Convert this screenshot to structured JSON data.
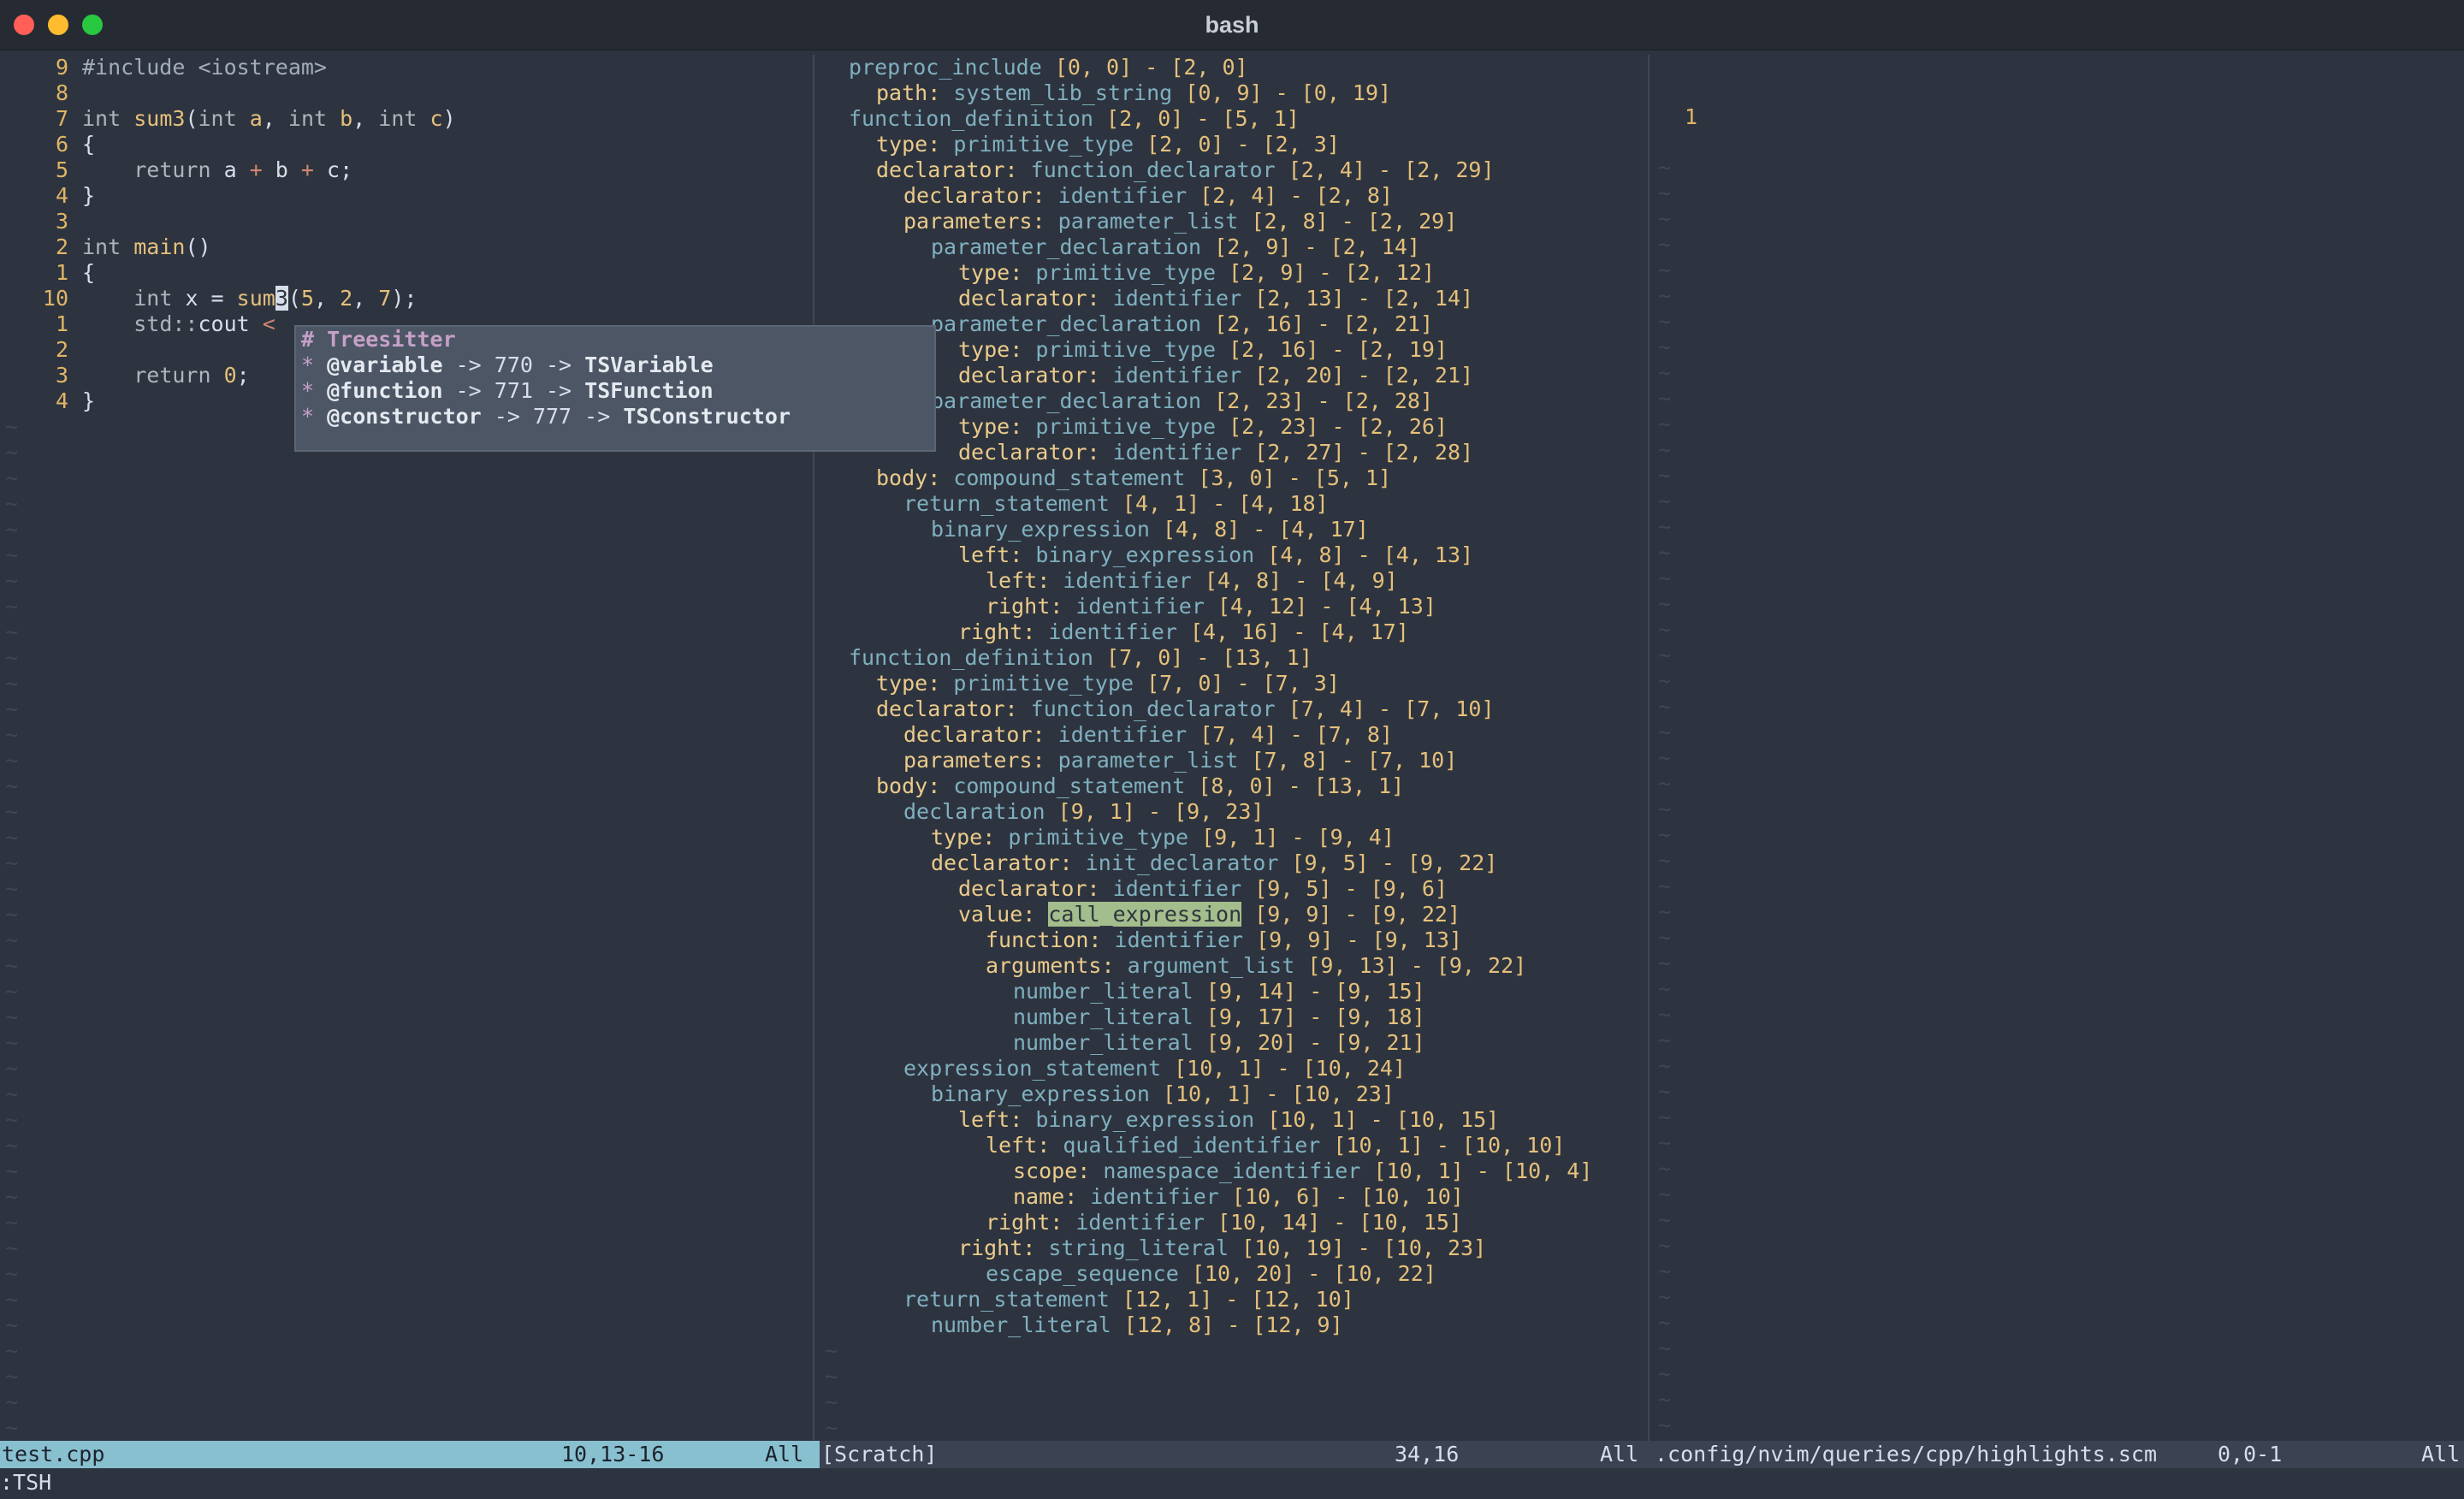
{
  "window": {
    "title": "bash"
  },
  "left": {
    "lines": [
      {
        "n": "9",
        "parts": [
          [
            "pp",
            "#include <iostream>"
          ]
        ]
      },
      {
        "n": "8",
        "parts": []
      },
      {
        "n": "7",
        "parts": [
          [
            "kw",
            "int "
          ],
          [
            "fn",
            "sum3"
          ],
          [
            "",
            "("
          ],
          [
            "kw",
            "int "
          ],
          [
            "fn",
            "a"
          ],
          [
            "",
            ", "
          ],
          [
            "kw",
            "int "
          ],
          [
            "fn",
            "b"
          ],
          [
            "",
            ", "
          ],
          [
            "kw",
            "int "
          ],
          [
            "fn",
            "c"
          ],
          [
            "",
            ")"
          ]
        ]
      },
      {
        "n": "6",
        "parts": [
          [
            "",
            "{"
          ]
        ]
      },
      {
        "n": "5",
        "parts": [
          [
            "",
            "    "
          ],
          [
            "kw",
            "return "
          ],
          [
            "",
            "a "
          ],
          [
            "op",
            "+"
          ],
          [
            "",
            " b "
          ],
          [
            "op",
            "+"
          ],
          [
            "",
            " c;"
          ]
        ]
      },
      {
        "n": "4",
        "parts": [
          [
            "",
            "}"
          ]
        ]
      },
      {
        "n": "3",
        "parts": []
      },
      {
        "n": "2",
        "parts": [
          [
            "kw",
            "int "
          ],
          [
            "fn",
            "main"
          ],
          [
            "",
            "()"
          ]
        ]
      },
      {
        "n": "1",
        "parts": [
          [
            "",
            "{"
          ]
        ]
      },
      {
        "n": "10",
        "cur": true,
        "parts": [
          [
            "",
            "    "
          ],
          [
            "kw",
            "int "
          ],
          [
            "",
            "x = "
          ],
          [
            "fn",
            "sum"
          ],
          [
            "cursor",
            "3"
          ],
          [
            "",
            "("
          ],
          [
            "num",
            "5"
          ],
          [
            "",
            ", "
          ],
          [
            "num",
            "2"
          ],
          [
            "",
            ", "
          ],
          [
            "num",
            "7"
          ],
          [
            "",
            ");"
          ]
        ]
      },
      {
        "n": "1",
        "parts": [
          [
            "",
            "    "
          ],
          [
            "kw",
            "std::"
          ],
          [
            "",
            "cout "
          ],
          [
            "op",
            "<"
          ]
        ]
      },
      {
        "n": "2",
        "parts": []
      },
      {
        "n": "3",
        "parts": [
          [
            "",
            "    "
          ],
          [
            "kw",
            "return "
          ],
          [
            "num",
            "0"
          ],
          [
            "",
            ";"
          ]
        ]
      },
      {
        "n": "4",
        "parts": [
          [
            "",
            "}"
          ]
        ]
      }
    ]
  },
  "popup": {
    "title": "# Treesitter",
    "rows": [
      {
        "cap": "@variable",
        "id": "770",
        "group": "TSVariable"
      },
      {
        "cap": "@function",
        "id": "771",
        "group": "TSFunction"
      },
      {
        "cap": "@constructor",
        "id": "777",
        "group": "TSConstructor"
      }
    ]
  },
  "tree": [
    [
      0,
      "",
      "preproc_include",
      "[0, 0] - [2, 0]"
    ],
    [
      1,
      "path:",
      "system_lib_string",
      "[0, 9] - [0, 19]"
    ],
    [
      0,
      "",
      "function_definition",
      "[2, 0] - [5, 1]"
    ],
    [
      1,
      "type:",
      "primitive_type",
      "[2, 0] - [2, 3]"
    ],
    [
      1,
      "declarator:",
      "function_declarator",
      "[2, 4] - [2, 29]"
    ],
    [
      2,
      "declarator:",
      "identifier",
      "[2, 4] - [2, 8]"
    ],
    [
      2,
      "parameters:",
      "parameter_list",
      "[2, 8] - [2, 29]"
    ],
    [
      3,
      "",
      "parameter_declaration",
      "[2, 9] - [2, 14]"
    ],
    [
      4,
      "type:",
      "primitive_type",
      "[2, 9] - [2, 12]"
    ],
    [
      4,
      "declarator:",
      "identifier",
      "[2, 13] - [2, 14]"
    ],
    [
      3,
      "",
      "parameter_declaration",
      "[2, 16] - [2, 21]"
    ],
    [
      4,
      "type:",
      "primitive_type",
      "[2, 16] - [2, 19]"
    ],
    [
      4,
      "declarator:",
      "identifier",
      "[2, 20] - [2, 21]"
    ],
    [
      3,
      "",
      "parameter_declaration",
      "[2, 23] - [2, 28]"
    ],
    [
      4,
      "type:",
      "primitive_type",
      "[2, 23] - [2, 26]"
    ],
    [
      4,
      "declarator:",
      "identifier",
      "[2, 27] - [2, 28]"
    ],
    [
      1,
      "body:",
      "compound_statement",
      "[3, 0] - [5, 1]"
    ],
    [
      2,
      "",
      "return_statement",
      "[4, 1] - [4, 18]"
    ],
    [
      3,
      "",
      "binary_expression",
      "[4, 8] - [4, 17]"
    ],
    [
      4,
      "left:",
      "binary_expression",
      "[4, 8] - [4, 13]"
    ],
    [
      5,
      "left:",
      "identifier",
      "[4, 8] - [4, 9]"
    ],
    [
      5,
      "right:",
      "identifier",
      "[4, 12] - [4, 13]"
    ],
    [
      4,
      "right:",
      "identifier",
      "[4, 16] - [4, 17]"
    ],
    [
      0,
      "",
      "function_definition",
      "[7, 0] - [13, 1]"
    ],
    [
      1,
      "type:",
      "primitive_type",
      "[7, 0] - [7, 3]"
    ],
    [
      1,
      "declarator:",
      "function_declarator",
      "[7, 4] - [7, 10]"
    ],
    [
      2,
      "declarator:",
      "identifier",
      "[7, 4] - [7, 8]"
    ],
    [
      2,
      "parameters:",
      "parameter_list",
      "[7, 8] - [7, 10]"
    ],
    [
      1,
      "body:",
      "compound_statement",
      "[8, 0] - [13, 1]"
    ],
    [
      2,
      "",
      "declaration",
      "[9, 1] - [9, 23]"
    ],
    [
      3,
      "type:",
      "primitive_type",
      "[9, 1] - [9, 4]"
    ],
    [
      3,
      "declarator:",
      "init_declarator",
      "[9, 5] - [9, 22]"
    ],
    [
      4,
      "declarator:",
      "identifier",
      "[9, 5] - [9, 6]"
    ],
    [
      4,
      "value:",
      "call_expression",
      "[9, 9] - [9, 22]",
      true
    ],
    [
      5,
      "function:",
      "identifier",
      "[9, 9] - [9, 13]"
    ],
    [
      5,
      "arguments:",
      "argument_list",
      "[9, 13] - [9, 22]"
    ],
    [
      6,
      "",
      "number_literal",
      "[9, 14] - [9, 15]"
    ],
    [
      6,
      "",
      "number_literal",
      "[9, 17] - [9, 18]"
    ],
    [
      6,
      "",
      "number_literal",
      "[9, 20] - [9, 21]"
    ],
    [
      2,
      "",
      "expression_statement",
      "[10, 1] - [10, 24]"
    ],
    [
      3,
      "",
      "binary_expression",
      "[10, 1] - [10, 23]"
    ],
    [
      4,
      "left:",
      "binary_expression",
      "[10, 1] - [10, 15]"
    ],
    [
      5,
      "left:",
      "qualified_identifier",
      "[10, 1] - [10, 10]"
    ],
    [
      6,
      "scope:",
      "namespace_identifier",
      "[10, 1] - [10, 4]"
    ],
    [
      6,
      "name:",
      "identifier",
      "[10, 6] - [10, 10]"
    ],
    [
      5,
      "right:",
      "identifier",
      "[10, 14] - [10, 15]"
    ],
    [
      4,
      "right:",
      "string_literal",
      "[10, 19] - [10, 23]"
    ],
    [
      5,
      "",
      "escape_sequence",
      "[10, 20] - [10, 22]"
    ],
    [
      2,
      "",
      "return_statement",
      "[12, 1] - [12, 10]"
    ],
    [
      3,
      "",
      "number_literal",
      "[12, 8] - [12, 9]"
    ]
  ],
  "right": {
    "line_number": "1"
  },
  "status": {
    "left_file": "test.cpp",
    "left_pos": "10,13-16",
    "left_pct": "All",
    "mid_file": "[Scratch]",
    "mid_pos": "34,16",
    "mid_pct": "All",
    "right_file": ".config/nvim/queries/cpp/highlights.scm",
    "right_pos": "0,0-1",
    "right_pct": "All"
  },
  "cmdline": ":TSH",
  "colors": {
    "status_active": "#88c0d0",
    "node": "#7fb0c0",
    "field": "#ebcb8b",
    "highlight": "#a3be8c"
  }
}
